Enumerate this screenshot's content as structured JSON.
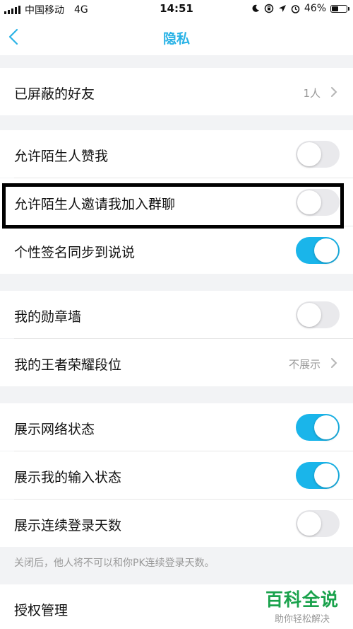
{
  "status_bar": {
    "carrier": "中国移动",
    "network": "4G",
    "time": "14:51",
    "battery": "46%"
  },
  "nav": {
    "title": "隐私"
  },
  "sections": {
    "blocked": {
      "label": "已屏蔽的好友",
      "value": "1人"
    },
    "stranger_like": {
      "label": "允许陌生人赞我",
      "on": false
    },
    "stranger_group": {
      "label": "允许陌生人邀请我加入群聊",
      "on": false
    },
    "signature_sync": {
      "label": "个性签名同步到说说",
      "on": true
    },
    "medal_wall": {
      "label": "我的勋章墙",
      "on": false
    },
    "honor_rank": {
      "label": "我的王者荣耀段位",
      "value": "不展示"
    },
    "network_status": {
      "label": "展示网络状态",
      "on": true
    },
    "typing_status": {
      "label": "展示我的输入状态",
      "on": true
    },
    "login_days": {
      "label": "展示连续登录天数",
      "on": false
    },
    "footnote": "关闭后，他人将不可以和你PK连续登录天数。",
    "auth": {
      "label": "授权管理"
    }
  },
  "watermark": {
    "big": "百科全说",
    "small": "助你轻松解决"
  },
  "colors": {
    "accent": "#1ab5ea",
    "title": "#2bb3e6",
    "toggle_off": "#e9e9ec"
  }
}
